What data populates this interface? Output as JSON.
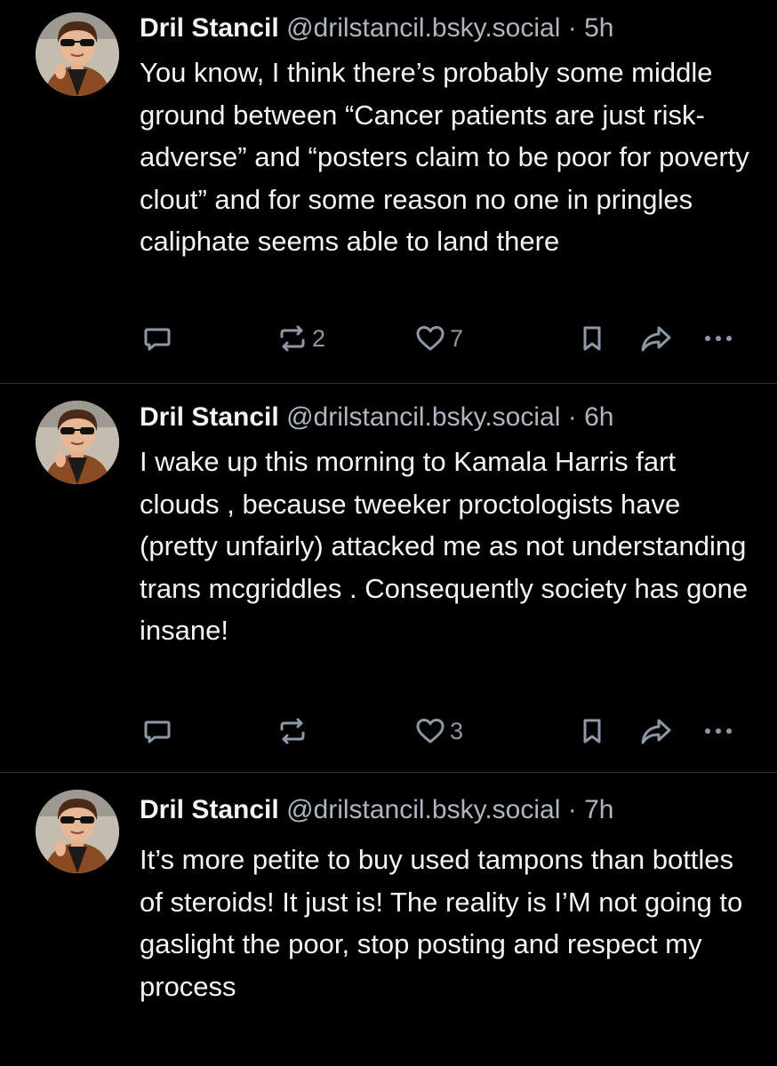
{
  "posts": [
    {
      "display_name": "Dril Stancil",
      "handle": "@drilstancil.bsky.social",
      "separator": "·",
      "time": "5h",
      "text": "You know, I think there’s probably some middle ground between “Cancer patients are just risk-adverse” and “posters claim to be poor for poverty clout” and for some reason no one in pringles caliphate seems able to land there",
      "actions": {
        "reply_icon": "reply-icon",
        "repost_icon": "repost-icon",
        "repost_count": "2",
        "like_icon": "heart-icon",
        "like_count": "7",
        "bookmark_icon": "bookmark-icon",
        "share_icon": "share-icon",
        "more_icon": "more-icon"
      }
    },
    {
      "display_name": "Dril Stancil",
      "handle": "@drilstancil.bsky.social",
      "separator": "·",
      "time": "6h",
      "text": "I wake up this morning to Kamala Harris fart clouds , because tweeker proctologists have (pretty unfairly) attacked me as not understanding trans mcgriddles . Consequently society has gone insane!",
      "actions": {
        "reply_icon": "reply-icon",
        "repost_icon": "repost-icon",
        "repost_count": "",
        "like_icon": "heart-icon",
        "like_count": "3",
        "bookmark_icon": "bookmark-icon",
        "share_icon": "share-icon",
        "more_icon": "more-icon"
      }
    },
    {
      "display_name": "Dril Stancil",
      "handle": "@drilstancil.bsky.social",
      "separator": "·",
      "time": "7h",
      "text": "It’s more petite to buy used tampons than bottles of steroids! It just is! The reality is I’M not going to gaslight the poor, stop posting and respect my process"
    }
  ],
  "theme": {
    "background": "#000000",
    "text": "#f1f3f5",
    "muted": "#aeb6c0",
    "icon": "#8d98a6",
    "divider": "#2b2f36"
  }
}
